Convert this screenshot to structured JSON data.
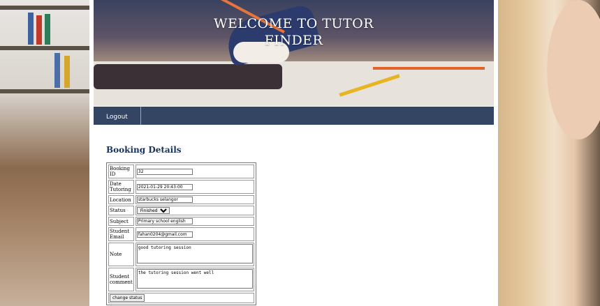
{
  "banner": {
    "title_line1": "WELCOME TO TUTOR",
    "title_line2": "FINDER"
  },
  "nav": {
    "items": [
      {
        "label": "Logout"
      }
    ]
  },
  "booking": {
    "heading": "Booking Details",
    "fields": {
      "booking_id": {
        "label": "Booking ID",
        "value": "32"
      },
      "date_tutoring": {
        "label": "Date Tutoring",
        "value": "2021-01-29 20:43:00"
      },
      "location": {
        "label": "Location",
        "value": "starbucks selangor"
      },
      "status": {
        "label": "Status",
        "value": "Finished"
      },
      "subject": {
        "label": "Subject",
        "value": "Primary school english"
      },
      "student_email": {
        "label": "Student Email",
        "value": "fahan0204@gmail.com"
      },
      "note": {
        "label": "Note",
        "value": "good tutoring session"
      },
      "student_comment": {
        "label": "Student comment",
        "value": "the tutoring session went well"
      }
    },
    "change_status_label": "change status"
  }
}
